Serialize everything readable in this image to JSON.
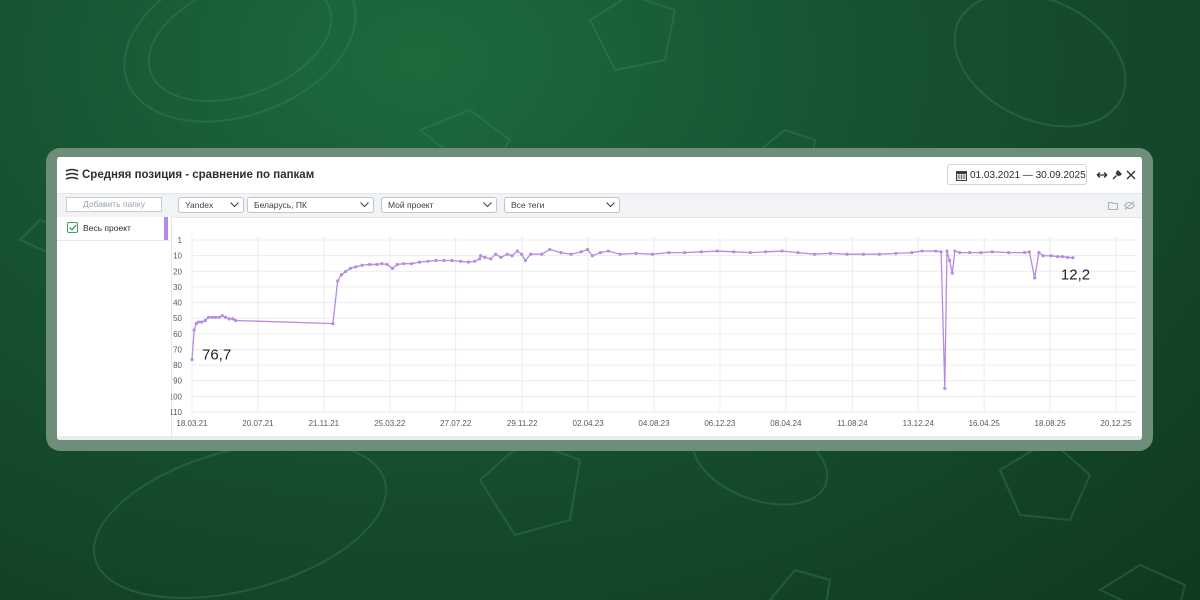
{
  "window": {
    "title": "Средняя позиция - сравнение по папкам",
    "date_range": "01.03.2021 — 30.09.2025"
  },
  "toolbar": {
    "add_folder_placeholder": "Добавить папку",
    "search_engine": "Yandex",
    "region": "Беларусь, ПК",
    "project": "Мой проект",
    "tags": "Все теги"
  },
  "sidebar": {
    "items": [
      {
        "label": "Весь проект",
        "checked": true,
        "color": "#b58be3"
      }
    ]
  },
  "colors": {
    "accent": "#b58be3",
    "checkbox": "#3aa064"
  },
  "chart_data": {
    "type": "line",
    "title": "",
    "xlabel": "",
    "ylabel": "",
    "y_inverted": true,
    "ylim": [
      1,
      110
    ],
    "y_ticks": [
      "1",
      "10",
      "20",
      "30",
      "40",
      "50",
      "60",
      "70",
      "80",
      "90",
      "100",
      "110"
    ],
    "x_ticks": [
      "18.03.21",
      "20.07.21",
      "21.11.21",
      "25.03.22",
      "27.07.22",
      "29.11.22",
      "02.04.23",
      "04.08.23",
      "06.12.23",
      "08.04.24",
      "11.08.24",
      "13.12.24",
      "16.04.25",
      "18.08.25",
      "20.12.25"
    ],
    "annotations": [
      {
        "text": "76,7",
        "x": "2021-03-18",
        "y": 76.7
      },
      {
        "text": "12,2",
        "x": "2025-09-30",
        "y": 12.2
      }
    ],
    "series": [
      {
        "color": "#b58be3",
        "points": [
          [
            "2021-03-18",
            76.7
          ],
          [
            "2021-03-22",
            58
          ],
          [
            "2021-03-26",
            54
          ],
          [
            "2021-03-30",
            53
          ],
          [
            "2021-04-05",
            53
          ],
          [
            "2021-04-12",
            52
          ],
          [
            "2021-04-18",
            50
          ],
          [
            "2021-04-25",
            50
          ],
          [
            "2021-05-01",
            50
          ],
          [
            "2021-05-08",
            50
          ],
          [
            "2021-05-14",
            49
          ],
          [
            "2021-05-20",
            50
          ],
          [
            "2021-05-27",
            51
          ],
          [
            "2021-06-03",
            51
          ],
          [
            "2021-06-08",
            52
          ],
          [
            "2021-12-08",
            54
          ],
          [
            "2021-12-17",
            27
          ],
          [
            "2021-12-24",
            23
          ],
          [
            "2022-01-01",
            21
          ],
          [
            "2022-01-10",
            19
          ],
          [
            "2022-01-20",
            18
          ],
          [
            "2022-02-01",
            17
          ],
          [
            "2022-02-15",
            16.5
          ],
          [
            "2022-03-01",
            16.5
          ],
          [
            "2022-03-10",
            16
          ],
          [
            "2022-03-20",
            16.5
          ],
          [
            "2022-03-30",
            19
          ],
          [
            "2022-04-08",
            16.5
          ],
          [
            "2022-04-20",
            16
          ],
          [
            "2022-05-05",
            16
          ],
          [
            "2022-05-20",
            15
          ],
          [
            "2022-06-05",
            14.5
          ],
          [
            "2022-06-20",
            14
          ],
          [
            "2022-07-05",
            14
          ],
          [
            "2022-07-20",
            14
          ],
          [
            "2022-08-05",
            14.5
          ],
          [
            "2022-08-20",
            15
          ],
          [
            "2022-09-01",
            14.5
          ],
          [
            "2022-09-10",
            13
          ],
          [
            "2022-09-12",
            11
          ],
          [
            "2022-09-20",
            12
          ],
          [
            "2022-10-01",
            13
          ],
          [
            "2022-10-10",
            10
          ],
          [
            "2022-10-20",
            12
          ],
          [
            "2022-11-01",
            10
          ],
          [
            "2022-11-10",
            11
          ],
          [
            "2022-11-20",
            8
          ],
          [
            "2022-11-28",
            10
          ],
          [
            "2022-12-05",
            14
          ],
          [
            "2022-12-15",
            10
          ],
          [
            "2023-01-05",
            10
          ],
          [
            "2023-01-20",
            7
          ],
          [
            "2023-02-10",
            9
          ],
          [
            "2023-03-01",
            10
          ],
          [
            "2023-03-20",
            8.5
          ],
          [
            "2023-04-01",
            7
          ],
          [
            "2023-04-10",
            11
          ],
          [
            "2023-04-25",
            9
          ],
          [
            "2023-05-10",
            8
          ],
          [
            "2023-06-01",
            10
          ],
          [
            "2023-07-01",
            9.5
          ],
          [
            "2023-08-01",
            10
          ],
          [
            "2023-09-01",
            9
          ],
          [
            "2023-10-01",
            9
          ],
          [
            "2023-11-01",
            8.5
          ],
          [
            "2023-12-01",
            8
          ],
          [
            "2024-01-01",
            8.5
          ],
          [
            "2024-02-01",
            9
          ],
          [
            "2024-03-01",
            8.5
          ],
          [
            "2024-04-01",
            8
          ],
          [
            "2024-05-01",
            9
          ],
          [
            "2024-06-01",
            10
          ],
          [
            "2024-07-01",
            9.5
          ],
          [
            "2024-08-01",
            10
          ],
          [
            "2024-09-01",
            10
          ],
          [
            "2024-10-01",
            10
          ],
          [
            "2024-11-01",
            9.5
          ],
          [
            "2024-12-01",
            9
          ],
          [
            "2024-12-20",
            8
          ],
          [
            "2025-01-15",
            8
          ],
          [
            "2025-01-25",
            8.5
          ],
          [
            "2025-02-01",
            95
          ],
          [
            "2025-02-05",
            8
          ],
          [
            "2025-02-10",
            14
          ],
          [
            "2025-02-15",
            22
          ],
          [
            "2025-02-20",
            8
          ],
          [
            "2025-03-01",
            9
          ],
          [
            "2025-03-20",
            9
          ],
          [
            "2025-04-10",
            9
          ],
          [
            "2025-05-01",
            8.5
          ],
          [
            "2025-06-01",
            9
          ],
          [
            "2025-07-01",
            9
          ],
          [
            "2025-07-10",
            8.5
          ],
          [
            "2025-07-20",
            25
          ],
          [
            "2025-07-28",
            9
          ],
          [
            "2025-08-05",
            11
          ],
          [
            "2025-08-20",
            11
          ],
          [
            "2025-09-01",
            11.5
          ],
          [
            "2025-09-10",
            11.5
          ],
          [
            "2025-09-20",
            12
          ],
          [
            "2025-09-30",
            12.2
          ]
        ]
      }
    ]
  }
}
